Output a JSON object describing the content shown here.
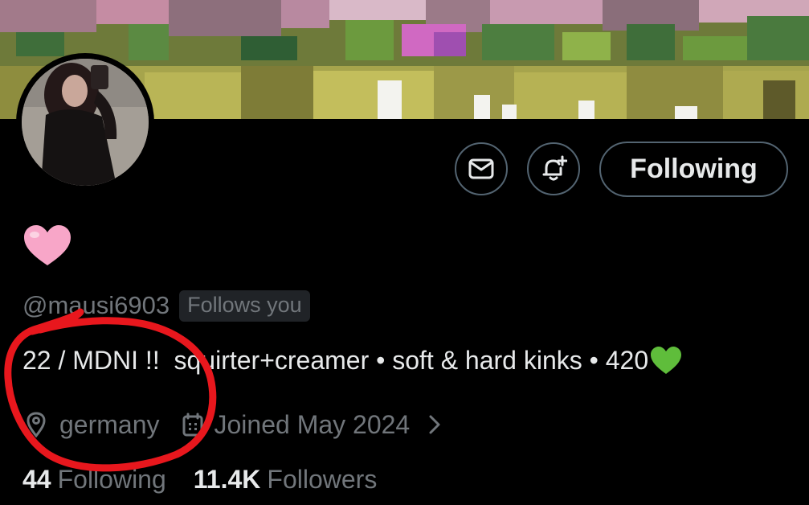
{
  "banner": {
    "description_icon": "pixel-garden-banner"
  },
  "avatar": {
    "icon": "profile-photo"
  },
  "actions": {
    "message_icon": "envelope-icon",
    "notify_icon": "bell-plus-icon",
    "follow_label": "Following"
  },
  "profile": {
    "display_name_emoji": "🩷",
    "handle": "@mausi6903",
    "follows_you": "Follows you",
    "bio": "22 / MDNI !!  squirter+creamer • soft & hard kinks • 420",
    "bio_trailing_emoji": "💚",
    "location": "germany",
    "joined": "Joined May 2024"
  },
  "stats": {
    "following_count": "44",
    "following_label": "Following",
    "followers_count": "11.4K",
    "followers_label": "Followers"
  },
  "colors": {
    "background": "#000000",
    "primary_text": "#e7e9ea",
    "secondary_text": "#71767b",
    "border": "#536471",
    "annotation": "#e8171d"
  }
}
